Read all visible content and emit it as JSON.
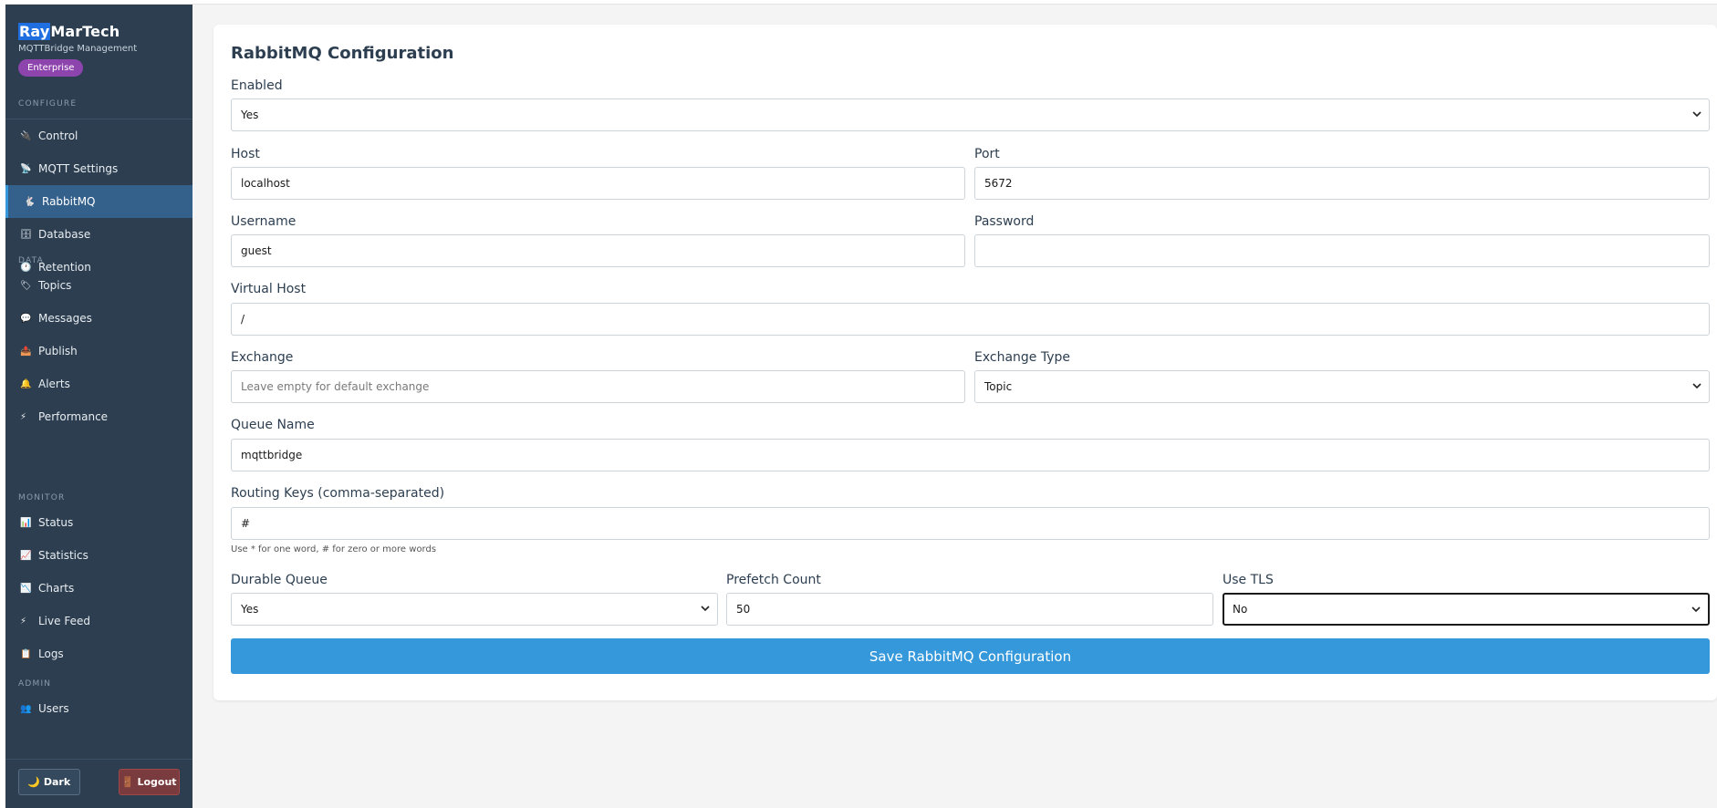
{
  "brand": {
    "title_highlight": "Ray",
    "title_rest": "MarTech",
    "subtitle": "MQTTBridge Management",
    "badge": "Enterprise"
  },
  "nav": {
    "configure_label": "CONFIGURE",
    "data_label": "DATA",
    "monitor_label": "MONITOR",
    "admin_label": "ADMIN",
    "items": [
      {
        "label": "Control",
        "icon": "🔌"
      },
      {
        "label": "MQTT Settings",
        "icon": "📡"
      },
      {
        "label": "RabbitMQ",
        "icon": "🐇"
      },
      {
        "label": "Database",
        "icon": "🗄"
      },
      {
        "label": "Retention",
        "icon": "🕐"
      },
      {
        "label": "Topics",
        "icon": "🏷"
      },
      {
        "label": "Messages",
        "icon": "💬"
      },
      {
        "label": "Publish",
        "icon": "📤"
      },
      {
        "label": "Alerts",
        "icon": "🔔"
      },
      {
        "label": "Performance",
        "icon": "⚡"
      },
      {
        "label": "Status",
        "icon": "📊"
      },
      {
        "label": "Statistics",
        "icon": "📈"
      },
      {
        "label": "Charts",
        "icon": "📉"
      },
      {
        "label": "Live Feed",
        "icon": "⚡"
      },
      {
        "label": "Logs",
        "icon": "📋"
      },
      {
        "label": "Users",
        "icon": "👥"
      }
    ],
    "active": "RabbitMQ"
  },
  "footer": {
    "dark_label": "🌙 Dark",
    "logout_label": "🚪 Logout"
  },
  "form": {
    "title": "RabbitMQ Configuration",
    "enabled": {
      "label": "Enabled",
      "value": "Yes"
    },
    "host": {
      "label": "Host",
      "value": "localhost"
    },
    "port": {
      "label": "Port",
      "value": "5672"
    },
    "username": {
      "label": "Username",
      "value": "guest"
    },
    "password": {
      "label": "Password",
      "value": ""
    },
    "vhost": {
      "label": "Virtual Host",
      "value": "/"
    },
    "exchange": {
      "label": "Exchange",
      "placeholder": "Leave empty for default exchange"
    },
    "exchange_type": {
      "label": "Exchange Type",
      "value": "Topic"
    },
    "queue_name": {
      "label": "Queue Name",
      "value": "mqttbridge"
    },
    "routing_keys": {
      "label": "Routing Keys (comma-separated)",
      "value": "#",
      "hint": "Use * for one word, # for zero or more words"
    },
    "durable": {
      "label": "Durable Queue",
      "value": "Yes"
    },
    "prefetch": {
      "label": "Prefetch Count",
      "value": "50"
    },
    "tls": {
      "label": "Use TLS",
      "value": "No"
    },
    "save_label": "Save RabbitMQ Configuration"
  },
  "colors": {
    "sidebar": "#2c3e50",
    "accent": "#3498db",
    "badge": "#8e44ad",
    "logout": "#7a3b3e"
  }
}
